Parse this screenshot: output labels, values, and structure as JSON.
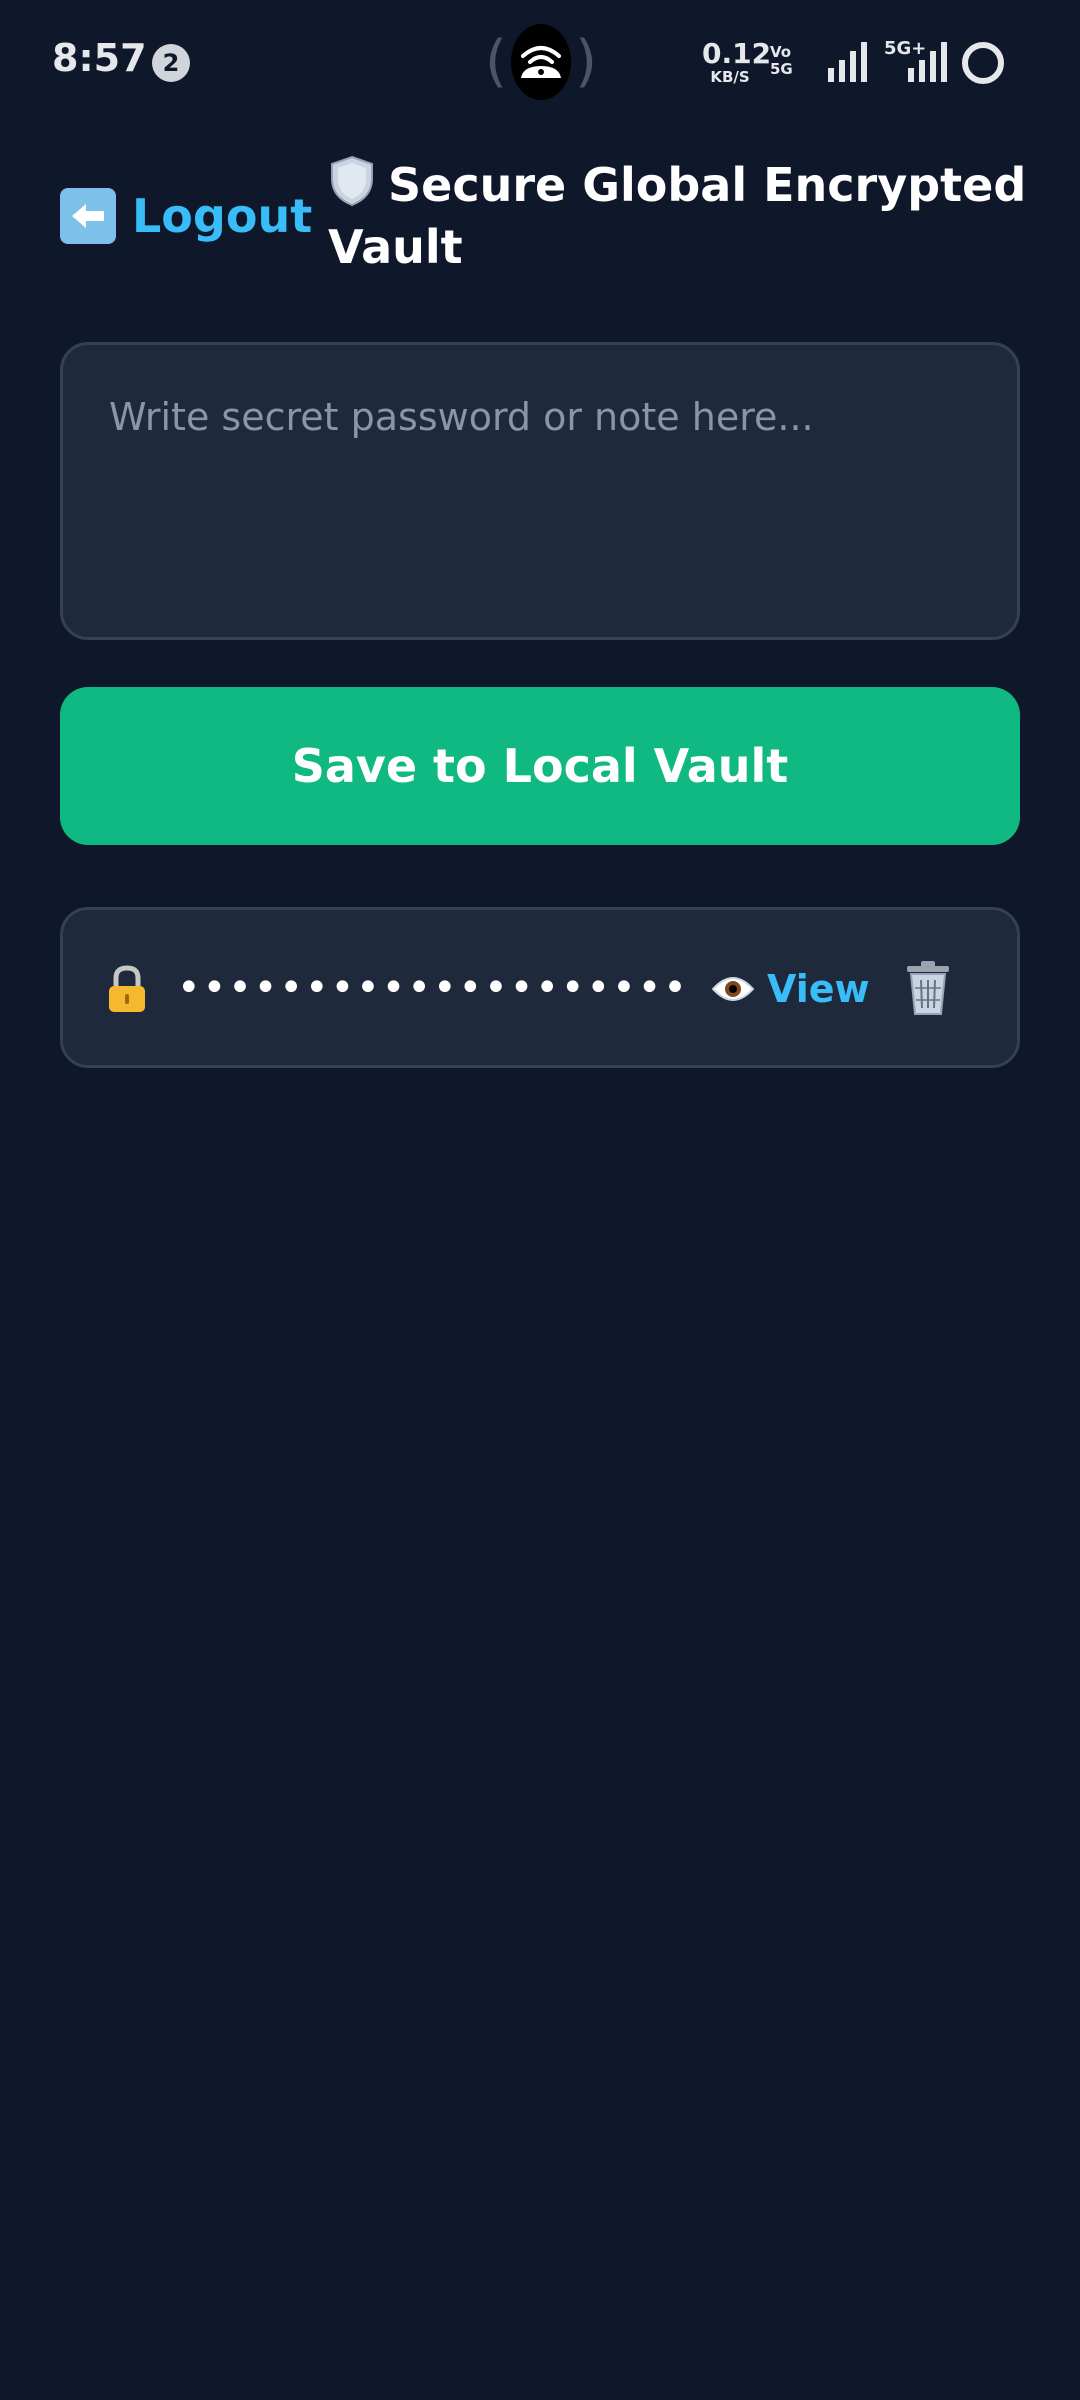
{
  "status_bar": {
    "time": "8:57",
    "notification_count": "2",
    "net_speed_value": "0.12",
    "net_speed_unit": "KB/S",
    "volte_line1": "Vo",
    "volte_line2": "5G",
    "network_type": "5G+"
  },
  "header": {
    "logout_label": "Logout",
    "title": "Secure Global Encrypted Vault"
  },
  "editor": {
    "value": "",
    "placeholder": "Write secret password or note here..."
  },
  "actions": {
    "save_label": "Save to Local Vault"
  },
  "vault": {
    "entries": [
      {
        "masked_value": "••••••••••••••••••••",
        "view_label": "View"
      }
    ]
  },
  "colors": {
    "background": "#0f172a",
    "card": "#1e293b",
    "card_border": "#334155",
    "accent_link": "#38bdf8",
    "primary_button": "#10b981"
  },
  "icons": {
    "back": "back-arrow-icon",
    "shield": "shield-icon",
    "lock": "lock-icon",
    "eye": "eye-icon",
    "trash": "trash-icon"
  }
}
